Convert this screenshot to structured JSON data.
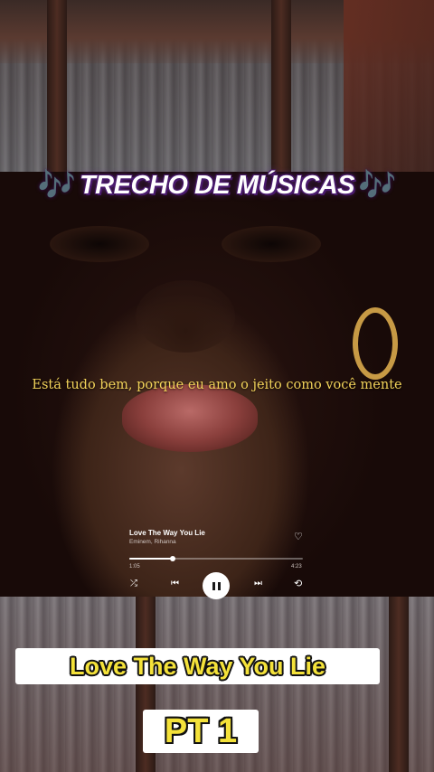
{
  "header": {
    "left_icon": "musical-notes-icon",
    "left_glyph": "🎶",
    "title": "TRECHO DE MÚSICAS",
    "right_icon": "musical-notes-icon",
    "right_glyph": "🎶"
  },
  "lyric": "Está tudo bem, porque eu amo o jeito como você mente",
  "player": {
    "song_title": "Love The Way You Lie",
    "artist": "Eminem, Rihanna",
    "elapsed": "1:05",
    "total": "4:23",
    "progress": 0.25,
    "icons": {
      "heart": "♡",
      "shuffle": "⤮",
      "prev": "⏮",
      "next": "⏭",
      "repeat": "⟲"
    },
    "state": "playing"
  },
  "caption": "Love The Way You Lie",
  "part_label": "PT 1",
  "colors": {
    "lyric": "#f2d35a",
    "caption_text": "#f4e23a",
    "note_icon": "#b05be0"
  }
}
